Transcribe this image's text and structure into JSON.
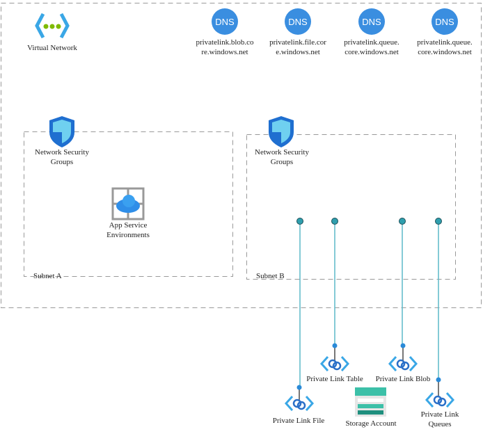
{
  "virtual_network": {
    "label": "Virtual Network",
    "icon": "virtual-network-icon"
  },
  "dns_zones": [
    {
      "line1": "privatelink.blob.co",
      "line2": "re.windows.net",
      "icon_text": "DNS"
    },
    {
      "line1": "privatelink.file.cor",
      "line2": "e.windows.net",
      "icon_text": "DNS"
    },
    {
      "line1": "privatelink.queue.",
      "line2": "core.windows.net",
      "icon_text": "DNS"
    },
    {
      "line1": "privatelink.queue.",
      "line2": "core.windows.net",
      "icon_text": "DNS"
    }
  ],
  "subnet_a": {
    "label": "Subnet A",
    "nsg_line1": "Network Security",
    "nsg_line2": "Groups",
    "ase_line1": "App Service",
    "ase_line2": "Environments"
  },
  "subnet_b": {
    "label": "Subnet B",
    "nsg_line1": "Network Security",
    "nsg_line2": "Groups"
  },
  "private_links": [
    {
      "label": "Private Link File"
    },
    {
      "label": "Private Link Table"
    },
    {
      "label": "Private Link Blob"
    },
    {
      "line1": "Private Link",
      "line2": "Queues"
    }
  ],
  "storage": {
    "label": "Storage Account"
  },
  "colors": {
    "dns": "#3a8ee0",
    "connector": "#5bb8c9",
    "endpoint": "#2f9fae",
    "link_icon": "#3aa7e6",
    "storage": "#3cc0a8"
  }
}
